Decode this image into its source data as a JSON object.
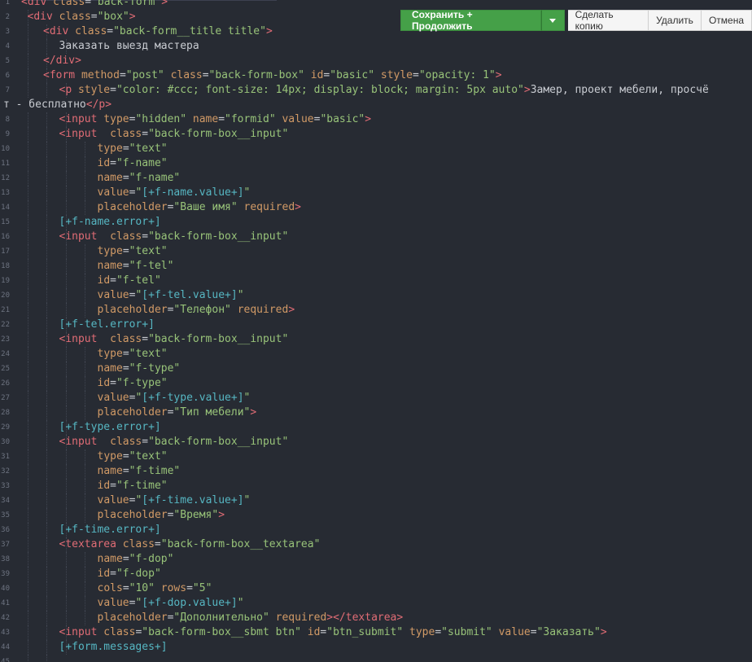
{
  "toolbar": {
    "save_continue": "Сохранить + Продолжить",
    "copy": "Сделать копию",
    "delete": "Удалить",
    "cancel": "Отмена"
  },
  "code_lines": [
    {
      "n": "1",
      "indent": 0,
      "parts": [
        [
          "tag",
          "<div "
        ],
        [
          "attr",
          "class"
        ],
        [
          "punc",
          "="
        ],
        [
          "str",
          "\"back-form\""
        ],
        [
          "tag",
          ">"
        ]
      ]
    },
    {
      "n": "2",
      "indent": 1,
      "parts": [
        [
          "tag",
          "<div "
        ],
        [
          "attr",
          "class"
        ],
        [
          "punc",
          "="
        ],
        [
          "str",
          "\"box\""
        ],
        [
          "tag",
          ">"
        ]
      ]
    },
    {
      "n": "3",
      "indent": 2,
      "parts": [
        [
          "tag",
          "<div "
        ],
        [
          "attr",
          "class"
        ],
        [
          "punc",
          "="
        ],
        [
          "str",
          "\"back-form__title title\""
        ],
        [
          "tag",
          ">"
        ]
      ]
    },
    {
      "n": "4",
      "indent": 3,
      "parts": [
        [
          "txt",
          "Заказать выезд мастера"
        ]
      ]
    },
    {
      "n": "5",
      "indent": 2,
      "parts": [
        [
          "tag",
          "</div>"
        ]
      ]
    },
    {
      "n": "6",
      "indent": 2,
      "parts": [
        [
          "tag",
          "<form "
        ],
        [
          "attr",
          "method"
        ],
        [
          "punc",
          "="
        ],
        [
          "str",
          "\"post\""
        ],
        [
          "punc",
          " "
        ],
        [
          "attr",
          "class"
        ],
        [
          "punc",
          "="
        ],
        [
          "str",
          "\"back-form-box\""
        ],
        [
          "punc",
          " "
        ],
        [
          "attr",
          "id"
        ],
        [
          "punc",
          "="
        ],
        [
          "str",
          "\"basic\""
        ],
        [
          "punc",
          " "
        ],
        [
          "attr",
          "style"
        ],
        [
          "punc",
          "="
        ],
        [
          "str",
          "\"opacity: 1\""
        ],
        [
          "tag",
          ">"
        ]
      ]
    },
    {
      "n": "7",
      "indent": 3,
      "parts": [
        [
          "tag",
          "<p "
        ],
        [
          "attr",
          "style"
        ],
        [
          "punc",
          "="
        ],
        [
          "str",
          "\"color: #ccc; font-size: 14px; display: block; margin: 5px auto\""
        ],
        [
          "tag",
          ">"
        ],
        [
          "txt",
          "Замер, проект мебели, просчё"
        ]
      ]
    },
    {
      "n": "",
      "indent": -1,
      "parts": [
        [
          "txt",
          "т - бесплатно"
        ],
        [
          "tag",
          "</p>"
        ]
      ]
    },
    {
      "n": "8",
      "indent": 3,
      "parts": [
        [
          "tag",
          "<input "
        ],
        [
          "attr",
          "type"
        ],
        [
          "punc",
          "="
        ],
        [
          "str",
          "\"hidden\""
        ],
        [
          "punc",
          " "
        ],
        [
          "attr",
          "name"
        ],
        [
          "punc",
          "="
        ],
        [
          "str",
          "\"formid\""
        ],
        [
          "punc",
          " "
        ],
        [
          "attr",
          "value"
        ],
        [
          "punc",
          "="
        ],
        [
          "str",
          "\"basic\""
        ],
        [
          "tag",
          ">"
        ]
      ]
    },
    {
      "n": "9",
      "indent": 3,
      "parts": [
        [
          "tag",
          "<input  "
        ],
        [
          "attr",
          "class"
        ],
        [
          "punc",
          "="
        ],
        [
          "str",
          "\"back-form-box__input\""
        ]
      ]
    },
    {
      "n": "10",
      "indent": 5,
      "parts": [
        [
          "attr",
          "type"
        ],
        [
          "punc",
          "="
        ],
        [
          "str",
          "\"text\""
        ]
      ]
    },
    {
      "n": "11",
      "indent": 5,
      "parts": [
        [
          "attr",
          "id"
        ],
        [
          "punc",
          "="
        ],
        [
          "str",
          "\"f-name\""
        ]
      ]
    },
    {
      "n": "12",
      "indent": 5,
      "parts": [
        [
          "attr",
          "name"
        ],
        [
          "punc",
          "="
        ],
        [
          "str",
          "\"f-name\""
        ]
      ]
    },
    {
      "n": "13",
      "indent": 5,
      "parts": [
        [
          "attr",
          "value"
        ],
        [
          "punc",
          "="
        ],
        [
          "str",
          "\""
        ],
        [
          "tpl",
          "[+f-name.value+]"
        ],
        [
          "str",
          "\""
        ]
      ]
    },
    {
      "n": "14",
      "indent": 5,
      "parts": [
        [
          "attr",
          "placeholder"
        ],
        [
          "punc",
          "="
        ],
        [
          "str",
          "\"Ваше имя\""
        ],
        [
          "punc",
          " "
        ],
        [
          "attr",
          "required"
        ],
        [
          "tag",
          ">"
        ]
      ]
    },
    {
      "n": "15",
      "indent": 3,
      "parts": [
        [
          "tpl",
          "[+f-name.error+]"
        ]
      ]
    },
    {
      "n": "16",
      "indent": 3,
      "parts": [
        [
          "tag",
          "<input  "
        ],
        [
          "attr",
          "class"
        ],
        [
          "punc",
          "="
        ],
        [
          "str",
          "\"back-form-box__input\""
        ]
      ]
    },
    {
      "n": "17",
      "indent": 5,
      "parts": [
        [
          "attr",
          "type"
        ],
        [
          "punc",
          "="
        ],
        [
          "str",
          "\"text\""
        ]
      ]
    },
    {
      "n": "18",
      "indent": 5,
      "parts": [
        [
          "attr",
          "name"
        ],
        [
          "punc",
          "="
        ],
        [
          "str",
          "\"f-tel\""
        ]
      ]
    },
    {
      "n": "19",
      "indent": 5,
      "parts": [
        [
          "attr",
          "id"
        ],
        [
          "punc",
          "="
        ],
        [
          "str",
          "\"f-tel\""
        ]
      ]
    },
    {
      "n": "20",
      "indent": 5,
      "parts": [
        [
          "attr",
          "value"
        ],
        [
          "punc",
          "="
        ],
        [
          "str",
          "\""
        ],
        [
          "tpl",
          "[+f-tel.value+]"
        ],
        [
          "str",
          "\""
        ]
      ]
    },
    {
      "n": "21",
      "indent": 5,
      "parts": [
        [
          "attr",
          "placeholder"
        ],
        [
          "punc",
          "="
        ],
        [
          "str",
          "\"Телефон\""
        ],
        [
          "punc",
          " "
        ],
        [
          "attr",
          "required"
        ],
        [
          "tag",
          ">"
        ]
      ]
    },
    {
      "n": "22",
      "indent": 3,
      "parts": [
        [
          "tpl",
          "[+f-tel.error+]"
        ]
      ]
    },
    {
      "n": "23",
      "indent": 3,
      "parts": [
        [
          "tag",
          "<input  "
        ],
        [
          "attr",
          "class"
        ],
        [
          "punc",
          "="
        ],
        [
          "str",
          "\"back-form-box__input\""
        ]
      ]
    },
    {
      "n": "24",
      "indent": 5,
      "parts": [
        [
          "attr",
          "type"
        ],
        [
          "punc",
          "="
        ],
        [
          "str",
          "\"text\""
        ]
      ]
    },
    {
      "n": "25",
      "indent": 5,
      "parts": [
        [
          "attr",
          "name"
        ],
        [
          "punc",
          "="
        ],
        [
          "str",
          "\"f-type\""
        ]
      ]
    },
    {
      "n": "26",
      "indent": 5,
      "parts": [
        [
          "attr",
          "id"
        ],
        [
          "punc",
          "="
        ],
        [
          "str",
          "\"f-type\""
        ]
      ]
    },
    {
      "n": "27",
      "indent": 5,
      "parts": [
        [
          "attr",
          "value"
        ],
        [
          "punc",
          "="
        ],
        [
          "str",
          "\""
        ],
        [
          "tpl",
          "[+f-type.value+]"
        ],
        [
          "str",
          "\""
        ]
      ]
    },
    {
      "n": "28",
      "indent": 5,
      "parts": [
        [
          "attr",
          "placeholder"
        ],
        [
          "punc",
          "="
        ],
        [
          "str",
          "\"Тип мебели\""
        ],
        [
          "tag",
          ">"
        ]
      ]
    },
    {
      "n": "29",
      "indent": 3,
      "parts": [
        [
          "tpl",
          "[+f-type.error+]"
        ]
      ]
    },
    {
      "n": "30",
      "indent": 3,
      "parts": [
        [
          "tag",
          "<input  "
        ],
        [
          "attr",
          "class"
        ],
        [
          "punc",
          "="
        ],
        [
          "str",
          "\"back-form-box__input\""
        ]
      ]
    },
    {
      "n": "31",
      "indent": 5,
      "parts": [
        [
          "attr",
          "type"
        ],
        [
          "punc",
          "="
        ],
        [
          "str",
          "\"text\""
        ]
      ]
    },
    {
      "n": "32",
      "indent": 5,
      "parts": [
        [
          "attr",
          "name"
        ],
        [
          "punc",
          "="
        ],
        [
          "str",
          "\"f-time\""
        ]
      ]
    },
    {
      "n": "33",
      "indent": 5,
      "parts": [
        [
          "attr",
          "id"
        ],
        [
          "punc",
          "="
        ],
        [
          "str",
          "\"f-time\""
        ]
      ]
    },
    {
      "n": "34",
      "indent": 5,
      "parts": [
        [
          "attr",
          "value"
        ],
        [
          "punc",
          "="
        ],
        [
          "str",
          "\""
        ],
        [
          "tpl",
          "[+f-time.value+]"
        ],
        [
          "str",
          "\""
        ]
      ]
    },
    {
      "n": "35",
      "indent": 5,
      "parts": [
        [
          "attr",
          "placeholder"
        ],
        [
          "punc",
          "="
        ],
        [
          "str",
          "\"Время\""
        ],
        [
          "tag",
          ">"
        ]
      ]
    },
    {
      "n": "36",
      "indent": 3,
      "parts": [
        [
          "tpl",
          "[+f-time.error+]"
        ]
      ]
    },
    {
      "n": "37",
      "indent": 3,
      "parts": [
        [
          "tag",
          "<textarea "
        ],
        [
          "attr",
          "class"
        ],
        [
          "punc",
          "="
        ],
        [
          "str",
          "\"back-form-box__textarea\""
        ]
      ]
    },
    {
      "n": "38",
      "indent": 5,
      "parts": [
        [
          "attr",
          "name"
        ],
        [
          "punc",
          "="
        ],
        [
          "str",
          "\"f-dop\""
        ]
      ]
    },
    {
      "n": "39",
      "indent": 5,
      "parts": [
        [
          "attr",
          "id"
        ],
        [
          "punc",
          "="
        ],
        [
          "str",
          "\"f-dop\""
        ]
      ]
    },
    {
      "n": "40",
      "indent": 5,
      "parts": [
        [
          "attr",
          "cols"
        ],
        [
          "punc",
          "="
        ],
        [
          "str",
          "\"10\""
        ],
        [
          "punc",
          " "
        ],
        [
          "attr",
          "rows"
        ],
        [
          "punc",
          "="
        ],
        [
          "str",
          "\"5\""
        ]
      ]
    },
    {
      "n": "41",
      "indent": 5,
      "parts": [
        [
          "attr",
          "value"
        ],
        [
          "punc",
          "="
        ],
        [
          "str",
          "\""
        ],
        [
          "tpl",
          "[+f-dop.value+]"
        ],
        [
          "str",
          "\""
        ]
      ]
    },
    {
      "n": "42",
      "indent": 5,
      "parts": [
        [
          "attr",
          "placeholder"
        ],
        [
          "punc",
          "="
        ],
        [
          "str",
          "\"Дополнительно\""
        ],
        [
          "punc",
          " "
        ],
        [
          "attr",
          "required"
        ],
        [
          "tag",
          "></textarea>"
        ]
      ]
    },
    {
      "n": "43",
      "indent": 3,
      "parts": [
        [
          "tag",
          "<input "
        ],
        [
          "attr",
          "class"
        ],
        [
          "punc",
          "="
        ],
        [
          "str",
          "\"back-form-box__sbmt btn\""
        ],
        [
          "punc",
          " "
        ],
        [
          "attr",
          "id"
        ],
        [
          "punc",
          "="
        ],
        [
          "str",
          "\"btn_submit\""
        ],
        [
          "punc",
          " "
        ],
        [
          "attr",
          "type"
        ],
        [
          "punc",
          "="
        ],
        [
          "str",
          "\"submit\""
        ],
        [
          "punc",
          " "
        ],
        [
          "attr",
          "value"
        ],
        [
          "punc",
          "="
        ],
        [
          "str",
          "\"Заказать\""
        ],
        [
          "tag",
          ">"
        ]
      ]
    },
    {
      "n": "44",
      "indent": 3,
      "parts": [
        [
          "tpl",
          "[+form.messages+]"
        ]
      ]
    },
    {
      "n": "45",
      "indent": 2,
      "parts": []
    }
  ]
}
